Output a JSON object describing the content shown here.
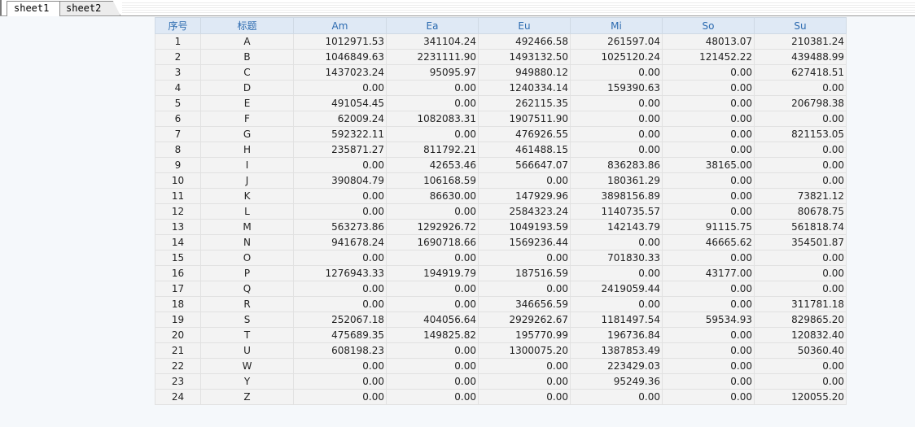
{
  "tabs": [
    {
      "label": "sheet1",
      "active": true
    },
    {
      "label": "sheet2",
      "active": false
    }
  ],
  "table": {
    "headers": [
      "序号",
      "标题",
      "Am",
      "Ea",
      "Eu",
      "Mi",
      "So",
      "Su"
    ],
    "rows": [
      [
        "1",
        "A",
        "1012971.53",
        "341104.24",
        "492466.58",
        "261597.04",
        "48013.07",
        "210381.24"
      ],
      [
        "2",
        "B",
        "1046849.63",
        "2231111.90",
        "1493132.50",
        "1025120.24",
        "121452.22",
        "439488.99"
      ],
      [
        "3",
        "C",
        "1437023.24",
        "95095.97",
        "949880.12",
        "0.00",
        "0.00",
        "627418.51"
      ],
      [
        "4",
        "D",
        "0.00",
        "0.00",
        "1240334.14",
        "159390.63",
        "0.00",
        "0.00"
      ],
      [
        "5",
        "E",
        "491054.45",
        "0.00",
        "262115.35",
        "0.00",
        "0.00",
        "206798.38"
      ],
      [
        "6",
        "F",
        "62009.24",
        "1082083.31",
        "1907511.90",
        "0.00",
        "0.00",
        "0.00"
      ],
      [
        "7",
        "G",
        "592322.11",
        "0.00",
        "476926.55",
        "0.00",
        "0.00",
        "821153.05"
      ],
      [
        "8",
        "H",
        "235871.27",
        "811792.21",
        "461488.15",
        "0.00",
        "0.00",
        "0.00"
      ],
      [
        "9",
        "I",
        "0.00",
        "42653.46",
        "566647.07",
        "836283.86",
        "38165.00",
        "0.00"
      ],
      [
        "10",
        "J",
        "390804.79",
        "106168.59",
        "0.00",
        "180361.29",
        "0.00",
        "0.00"
      ],
      [
        "11",
        "K",
        "0.00",
        "86630.00",
        "147929.96",
        "3898156.89",
        "0.00",
        "73821.12"
      ],
      [
        "12",
        "L",
        "0.00",
        "0.00",
        "2584323.24",
        "1140735.57",
        "0.00",
        "80678.75"
      ],
      [
        "13",
        "M",
        "563273.86",
        "1292926.72",
        "1049193.59",
        "142143.79",
        "91115.75",
        "561818.74"
      ],
      [
        "14",
        "N",
        "941678.24",
        "1690718.66",
        "1569236.44",
        "0.00",
        "46665.62",
        "354501.87"
      ],
      [
        "15",
        "O",
        "0.00",
        "0.00",
        "0.00",
        "701830.33",
        "0.00",
        "0.00"
      ],
      [
        "16",
        "P",
        "1276943.33",
        "194919.79",
        "187516.59",
        "0.00",
        "43177.00",
        "0.00"
      ],
      [
        "17",
        "Q",
        "0.00",
        "0.00",
        "0.00",
        "2419059.44",
        "0.00",
        "0.00"
      ],
      [
        "18",
        "R",
        "0.00",
        "0.00",
        "346656.59",
        "0.00",
        "0.00",
        "311781.18"
      ],
      [
        "19",
        "S",
        "252067.18",
        "404056.64",
        "2929262.67",
        "1181497.54",
        "59534.93",
        "829865.20"
      ],
      [
        "20",
        "T",
        "475689.35",
        "149825.82",
        "195770.99",
        "196736.84",
        "0.00",
        "120832.40"
      ],
      [
        "21",
        "U",
        "608198.23",
        "0.00",
        "1300075.20",
        "1387853.49",
        "0.00",
        "50360.40"
      ],
      [
        "22",
        "W",
        "0.00",
        "0.00",
        "0.00",
        "223429.03",
        "0.00",
        "0.00"
      ],
      [
        "23",
        "Y",
        "0.00",
        "0.00",
        "0.00",
        "95249.36",
        "0.00",
        "0.00"
      ],
      [
        "24",
        "Z",
        "0.00",
        "0.00",
        "0.00",
        "0.00",
        "0.00",
        "120055.20"
      ]
    ]
  }
}
